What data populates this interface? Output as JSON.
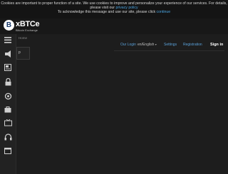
{
  "cookie_banner": {
    "line1": "Cookies are important to proper function of a site. We use cookies to improve and personalize your experience of our services. For details,",
    "line2_prefix": "please visit our",
    "privacy_link": "privacy policy",
    "line3_prefix": "To acknowledge this message and use our site, please click",
    "continue_link": "continue"
  },
  "brand": {
    "logo_letter": "B",
    "name": "xBTCe",
    "tagline": "Bitcoin Exchange"
  },
  "breadcrumb": "Home",
  "subpanel": {
    "text": "p"
  },
  "nav": {
    "login": "Our Login",
    "language": "en/English",
    "settings": "Settings",
    "registration": "Registration",
    "signin": "Sign in"
  },
  "rail_icons": [
    "menu-icon",
    "bullhorn-icon",
    "newspaper-icon",
    "lock-icon",
    "refresh-icon",
    "bag-icon",
    "tv-icon",
    "headset-icon",
    "calendar-icon"
  ]
}
